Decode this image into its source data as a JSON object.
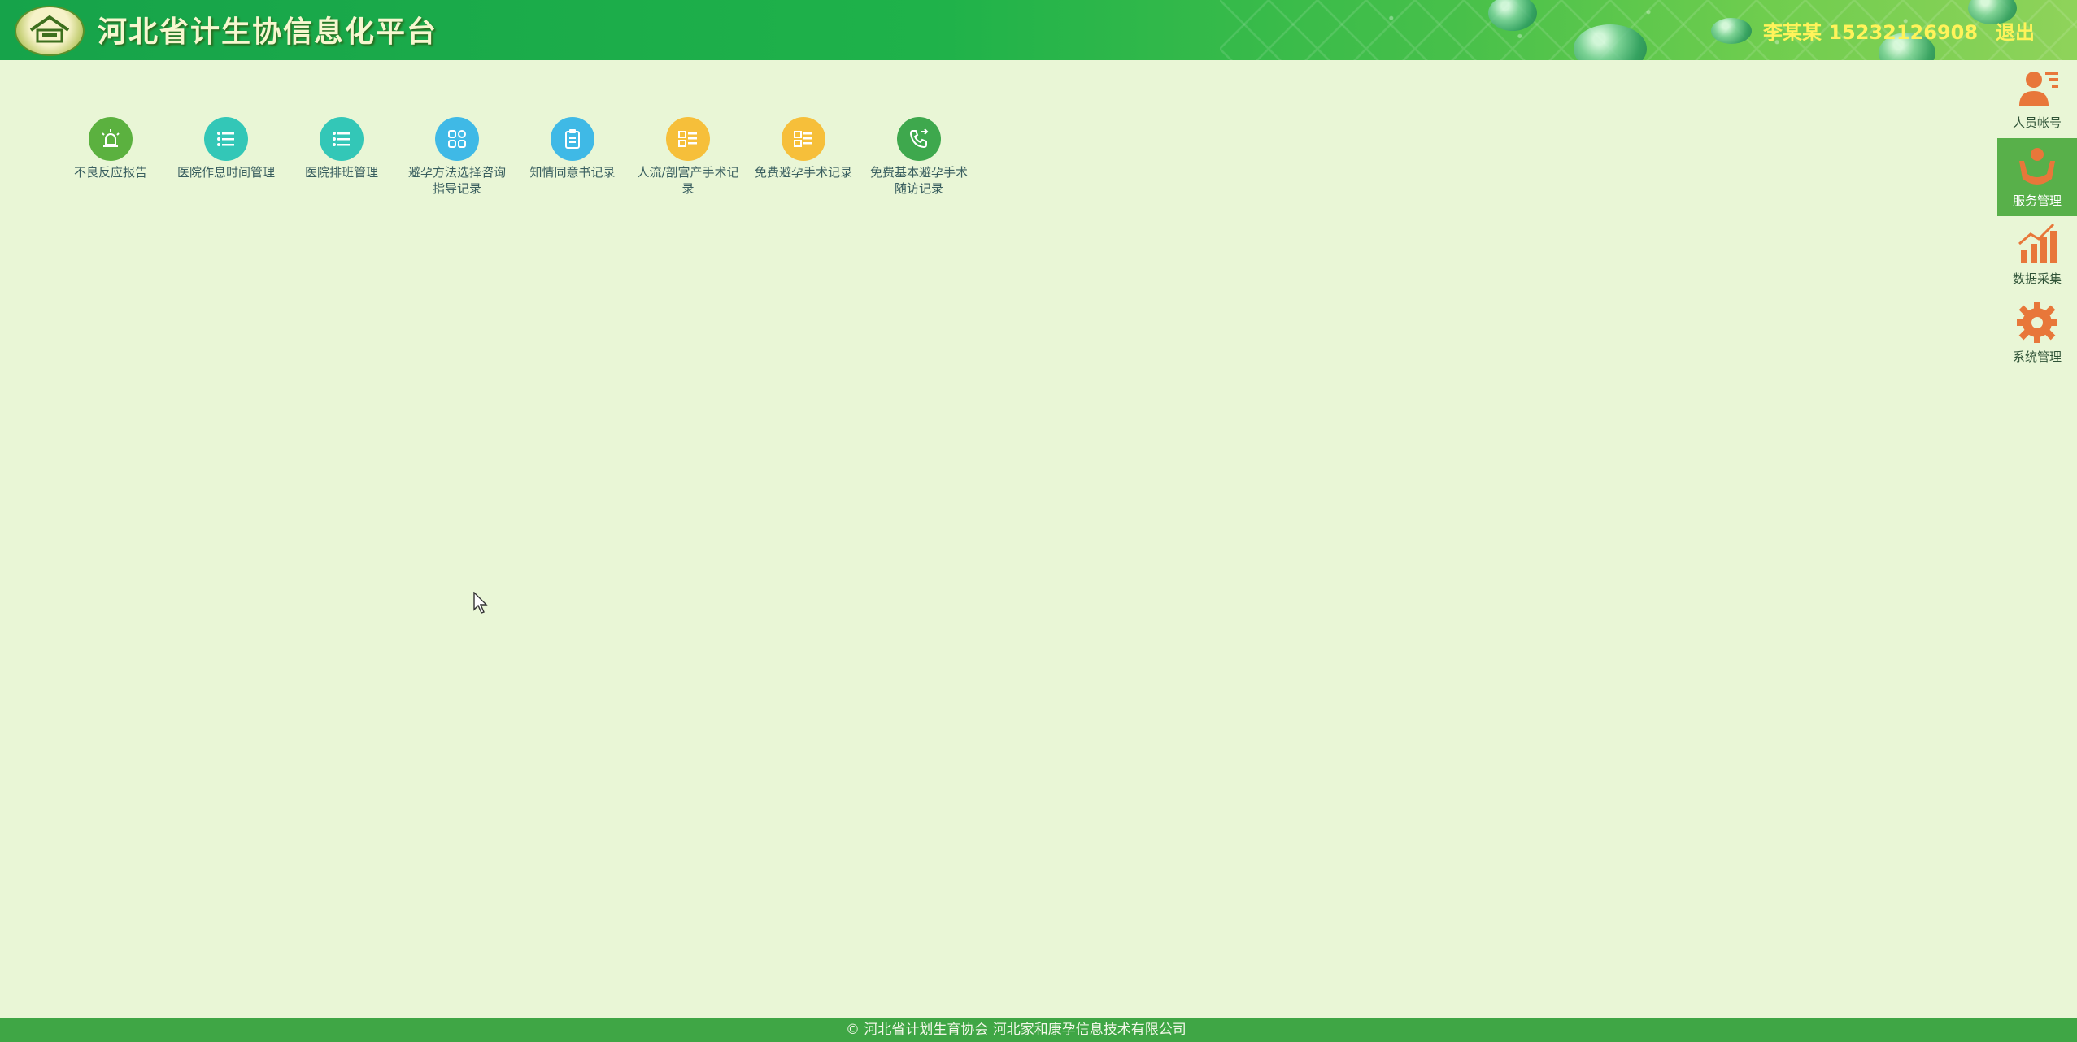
{
  "header": {
    "title": "河北省计生协信息化平台",
    "user": "李某某 15232126908",
    "logout": "退出"
  },
  "grid": {
    "items": [
      {
        "label": "不良反应报告",
        "icon": "alarm-icon",
        "color": "#5bb13f"
      },
      {
        "label": "医院作息时间管理",
        "icon": "list-icon",
        "color": "#33c7b7"
      },
      {
        "label": "医院排班管理",
        "icon": "list-icon",
        "color": "#33c7b7"
      },
      {
        "label": "避孕方法选择咨询指导记录",
        "icon": "grid-icon",
        "color": "#3fb9e6"
      },
      {
        "label": "知情同意书记录",
        "icon": "clipboard-icon",
        "color": "#3fb9e6"
      },
      {
        "label": "人流/剖宫产手术记录",
        "icon": "record-icon",
        "color": "#f6bf3a"
      },
      {
        "label": "免费避孕手术记录",
        "icon": "record-icon",
        "color": "#f6bf3a"
      },
      {
        "label": "免费基本避孕手术随访记录",
        "icon": "phone-icon",
        "color": "#3ea84d"
      }
    ]
  },
  "sidebar": {
    "items": [
      {
        "label": "人员帐号",
        "icon": "user-account-icon",
        "active": false
      },
      {
        "label": "服务管理",
        "icon": "service-hands-icon",
        "active": true
      },
      {
        "label": "数据采集",
        "icon": "bar-chart-icon",
        "active": false
      },
      {
        "label": "系统管理",
        "icon": "gear-icon",
        "active": false
      }
    ]
  },
  "footer": {
    "text": "© 河北省计划生育协会    河北家和康孕信息技术有限公司"
  },
  "colors": {
    "header_green": "#1fb24a",
    "page_bg": "#e9f6d6",
    "footer_green": "#3fa645",
    "accent_yellow": "#fff35a",
    "sidebar_orange": "#e8773a"
  }
}
